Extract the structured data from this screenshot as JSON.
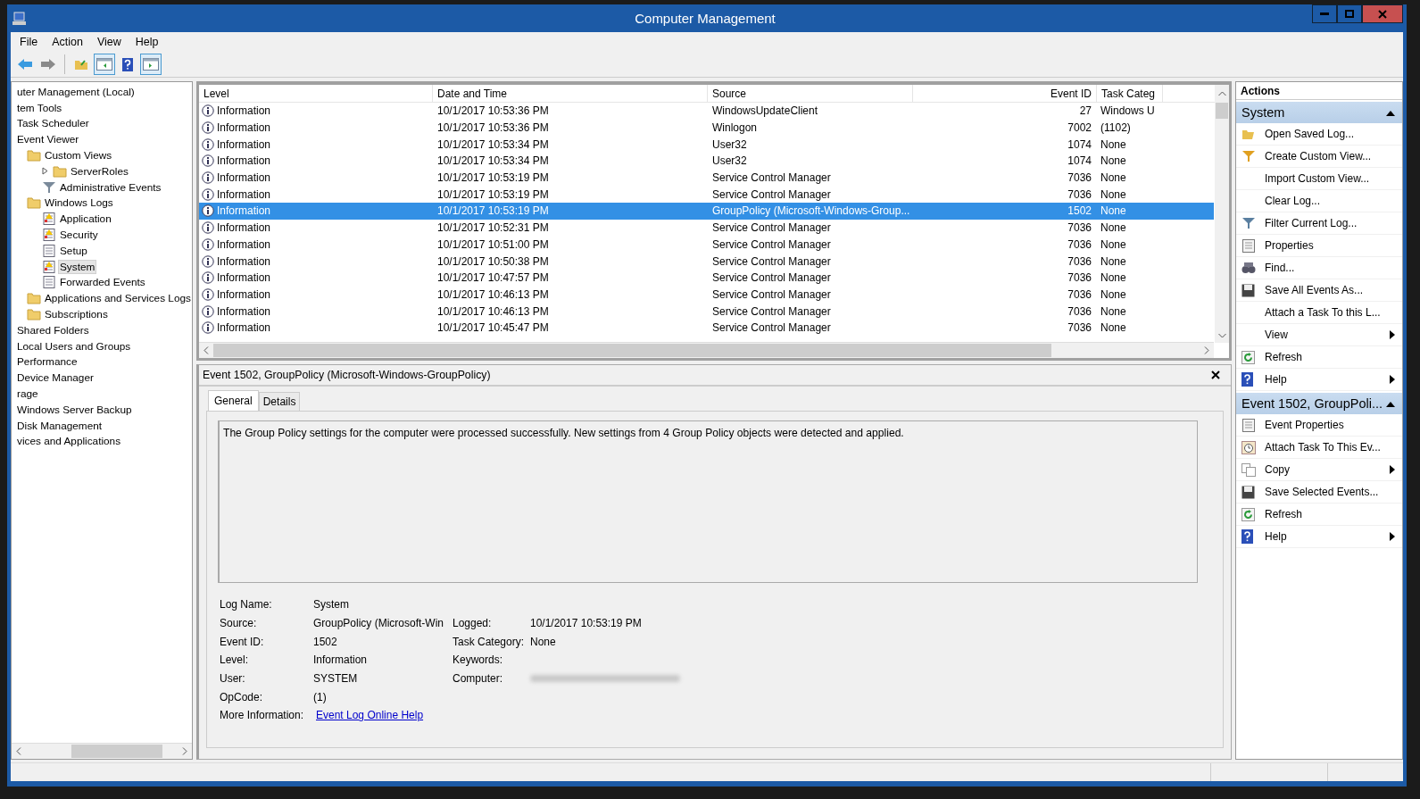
{
  "window": {
    "title": "Computer Management"
  },
  "menu": [
    "File",
    "Action",
    "View",
    "Help"
  ],
  "toolbar": [
    {
      "pressed": false
    },
    {
      "pressed": false
    },
    {
      "pressed": false
    },
    {
      "pressed": true
    },
    {
      "pressed": false
    },
    {
      "pressed": true
    }
  ],
  "tree": [
    {
      "label": "uter Management (Local)",
      "selected": false,
      "children": [
        {
          "label": "tem Tools",
          "selected": false,
          "children": [
            {
              "label": "Task Scheduler",
              "selected": false
            },
            {
              "label": "Event Viewer",
              "selected": false,
              "children": [
                {
                  "label": "Custom Views",
                  "kind": "folder",
                  "selected": false,
                  "children": [
                    {
                      "label": "ServerRoles",
                      "kind": "folder",
                      "selected": false,
                      "expanded": false
                    },
                    {
                      "label": "Administrative Events",
                      "kind": "filter",
                      "selected": false
                    }
                  ]
                },
                {
                  "label": "Windows Logs",
                  "kind": "folder",
                  "selected": false,
                  "children": [
                    {
                      "label": "Application",
                      "kind": "log-warn",
                      "selected": false
                    },
                    {
                      "label": "Security",
                      "kind": "log-warn",
                      "selected": false
                    },
                    {
                      "label": "Setup",
                      "kind": "log",
                      "selected": false
                    },
                    {
                      "label": "System",
                      "kind": "log-warn",
                      "selected": true
                    },
                    {
                      "label": "Forwarded Events",
                      "kind": "log",
                      "selected": false
                    }
                  ]
                },
                {
                  "label": "Applications and Services Logs",
                  "kind": "folder",
                  "selected": false
                },
                {
                  "label": "Subscriptions",
                  "kind": "folder",
                  "selected": false
                }
              ]
            },
            {
              "label": "Shared Folders",
              "selected": false
            },
            {
              "label": "Local Users and Groups",
              "selected": false
            },
            {
              "label": "Performance",
              "selected": false
            },
            {
              "label": "Device Manager",
              "selected": false
            }
          ]
        },
        {
          "label": "rage",
          "selected": false,
          "children": [
            {
              "label": "Windows Server Backup",
              "selected": false
            },
            {
              "label": "Disk Management",
              "selected": false
            }
          ]
        },
        {
          "label": "vices and Applications",
          "selected": false
        }
      ]
    }
  ],
  "events": {
    "columns": [
      "Level",
      "Date and Time",
      "Source",
      "Event ID",
      "Task Categ"
    ],
    "rows": [
      {
        "level": "Information",
        "date": "10/1/2017 10:53:36 PM",
        "source": "WindowsUpdateClient",
        "event_id": "27",
        "task_category": "Windows U",
        "selected": false
      },
      {
        "level": "Information",
        "date": "10/1/2017 10:53:36 PM",
        "source": "Winlogon",
        "event_id": "7002",
        "task_category": "(1102)",
        "selected": false
      },
      {
        "level": "Information",
        "date": "10/1/2017 10:53:34 PM",
        "source": "User32",
        "event_id": "1074",
        "task_category": "None",
        "selected": false
      },
      {
        "level": "Information",
        "date": "10/1/2017 10:53:34 PM",
        "source": "User32",
        "event_id": "1074",
        "task_category": "None",
        "selected": false
      },
      {
        "level": "Information",
        "date": "10/1/2017 10:53:19 PM",
        "source": "Service Control Manager",
        "event_id": "7036",
        "task_category": "None",
        "selected": false
      },
      {
        "level": "Information",
        "date": "10/1/2017 10:53:19 PM",
        "source": "Service Control Manager",
        "event_id": "7036",
        "task_category": "None",
        "selected": false
      },
      {
        "level": "Information",
        "date": "10/1/2017 10:53:19 PM",
        "source": "GroupPolicy (Microsoft-Windows-Group...",
        "event_id": "1502",
        "task_category": "None",
        "selected": true
      },
      {
        "level": "Information",
        "date": "10/1/2017 10:52:31 PM",
        "source": "Service Control Manager",
        "event_id": "7036",
        "task_category": "None",
        "selected": false
      },
      {
        "level": "Information",
        "date": "10/1/2017 10:51:00 PM",
        "source": "Service Control Manager",
        "event_id": "7036",
        "task_category": "None",
        "selected": false
      },
      {
        "level": "Information",
        "date": "10/1/2017 10:50:38 PM",
        "source": "Service Control Manager",
        "event_id": "7036",
        "task_category": "None",
        "selected": false
      },
      {
        "level": "Information",
        "date": "10/1/2017 10:47:57 PM",
        "source": "Service Control Manager",
        "event_id": "7036",
        "task_category": "None",
        "selected": false
      },
      {
        "level": "Information",
        "date": "10/1/2017 10:46:13 PM",
        "source": "Service Control Manager",
        "event_id": "7036",
        "task_category": "None",
        "selected": false
      },
      {
        "level": "Information",
        "date": "10/1/2017 10:46:13 PM",
        "source": "Service Control Manager",
        "event_id": "7036",
        "task_category": "None",
        "selected": false
      },
      {
        "level": "Information",
        "date": "10/1/2017 10:45:47 PM",
        "source": "Service Control Manager",
        "event_id": "7036",
        "task_category": "None",
        "selected": false
      }
    ]
  },
  "detail": {
    "title": "Event 1502, GroupPolicy (Microsoft-Windows-GroupPolicy)",
    "tabs": [
      {
        "label": "General",
        "selected": true
      },
      {
        "label": "Details",
        "selected": false
      }
    ],
    "description": "The Group Policy settings for the computer were processed successfully. New settings from 4 Group Policy objects were detected and applied.",
    "fields": [
      {
        "label": "Log Name:",
        "value": "System"
      },
      {
        "label": "Source:",
        "value": "GroupPolicy (Microsoft-Win",
        "right": {
          "label": "Logged:",
          "value": "10/1/2017 10:53:19 PM"
        }
      },
      {
        "label": "Event ID:",
        "value": "1502",
        "right": {
          "label": "Task Category:",
          "value": "None"
        }
      },
      {
        "label": "Level:",
        "value": "Information",
        "right": {
          "label": "Keywords:"
        }
      },
      {
        "label": "User:",
        "value": "SYSTEM",
        "right": {
          "label": "Computer:",
          "redacted": true
        }
      },
      {
        "label": "OpCode:",
        "value": "(1)"
      },
      {
        "label": "More Information:",
        "link": "Event Log Online Help"
      }
    ]
  },
  "actions": {
    "title": "Actions",
    "sections": [
      {
        "title": "System",
        "expanded": true,
        "items": [
          {
            "label": "Open Saved Log...",
            "kind": "open",
            "submenu": false
          },
          {
            "label": "Create Custom View...",
            "kind": "filter-new",
            "submenu": false
          },
          {
            "label": "Import Custom View...",
            "kind": "none",
            "submenu": false
          },
          {
            "label": "Clear Log...",
            "kind": "none",
            "submenu": false
          },
          {
            "label": "Filter Current Log...",
            "kind": "filter",
            "submenu": false
          },
          {
            "label": "Properties",
            "kind": "properties",
            "submenu": false
          },
          {
            "label": "Find...",
            "kind": "find",
            "submenu": false
          },
          {
            "label": "Save All Events As...",
            "kind": "save",
            "submenu": false
          },
          {
            "label": "Attach a Task To this L...",
            "kind": "none",
            "submenu": false
          },
          {
            "label": "View",
            "kind": "none",
            "submenu": true
          },
          {
            "label": "Refresh",
            "kind": "refresh",
            "submenu": false
          },
          {
            "label": "Help",
            "kind": "help",
            "submenu": true
          }
        ]
      },
      {
        "title": "Event 1502, GroupPoli...",
        "expanded": true,
        "items": [
          {
            "label": "Event Properties",
            "kind": "properties",
            "submenu": false
          },
          {
            "label": "Attach Task To This Ev...",
            "kind": "task",
            "submenu": false
          },
          {
            "label": "Copy",
            "kind": "copy",
            "submenu": true
          },
          {
            "label": "Save Selected Events...",
            "kind": "save",
            "submenu": false
          },
          {
            "label": "Refresh",
            "kind": "refresh",
            "submenu": false
          },
          {
            "label": "Help",
            "kind": "help",
            "submenu": true
          }
        ]
      }
    ]
  }
}
